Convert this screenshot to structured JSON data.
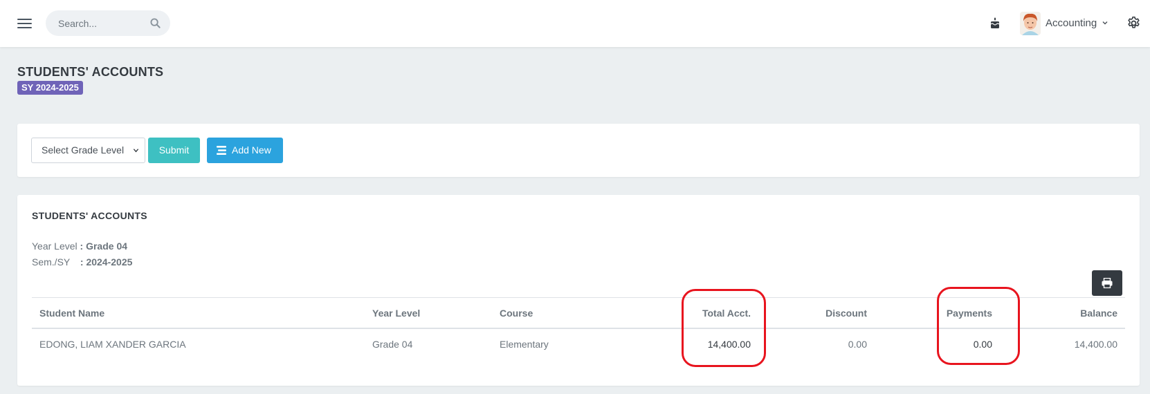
{
  "topbar": {
    "search_placeholder": "Search...",
    "user_label": "Accounting",
    "icons": [
      "menu-icon",
      "search-icon",
      "cake-icon",
      "avatar",
      "chevron-down-icon",
      "gear-icon"
    ]
  },
  "page": {
    "title": "STUDENTS' ACCOUNTS",
    "sy_badge": "SY 2024-2025"
  },
  "filter": {
    "select_placeholder": "Select Grade Level",
    "submit_label": "Submit",
    "add_new_label": "Add New"
  },
  "accounts": {
    "title": "STUDENTS' ACCOUNTS",
    "year_level_label": "Year Level",
    "year_level_value": ": Grade 04",
    "sem_label": "Sem./SY",
    "sem_value": ": 2024-2025",
    "columns": [
      "Student Name",
      "Year Level",
      "Course",
      "Total Acct.",
      "Discount",
      "Payments",
      "Balance"
    ],
    "rows": [
      [
        "EDONG, LIAM XANDER GARCIA",
        "Grade 04",
        "Elementary",
        "14,400.00",
        "0.00",
        "0.00",
        "14,400.00"
      ]
    ]
  },
  "colors": {
    "badge": "#6f63b8",
    "submit": "#3ec0c2",
    "add_new": "#2ba3de",
    "print": "#343a40",
    "highlight": "#e8141e"
  }
}
